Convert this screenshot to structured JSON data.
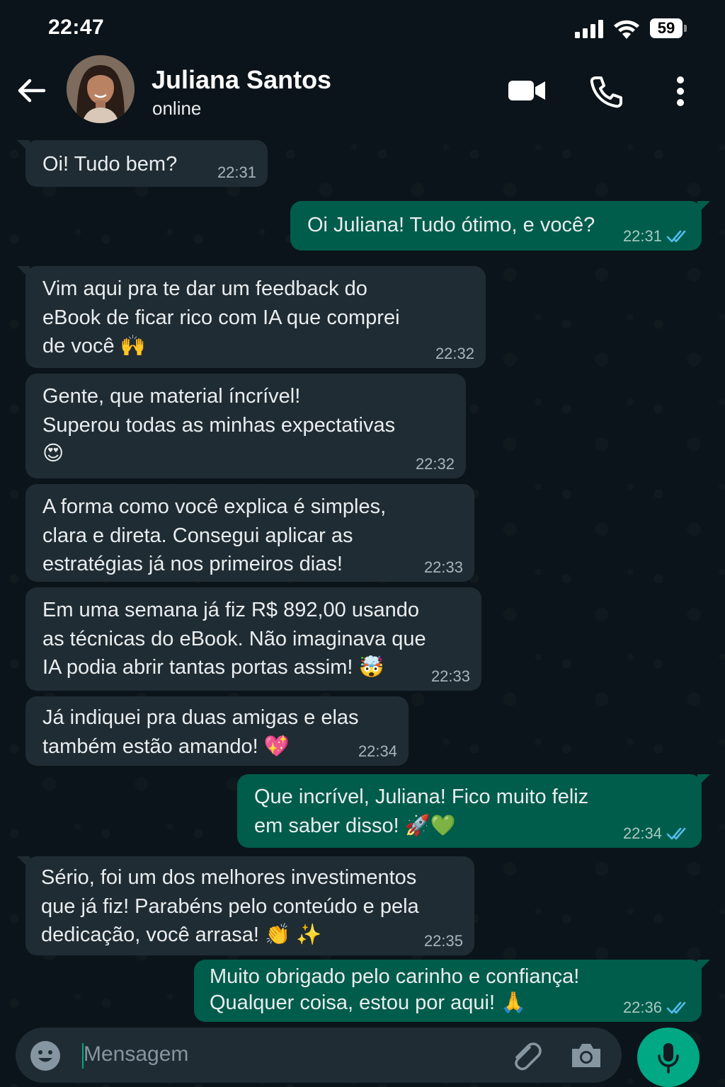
{
  "status_bar": {
    "time": "22:47",
    "battery": "59"
  },
  "header": {
    "contact_name": "Juliana Santos",
    "contact_status": "online"
  },
  "messages": [
    {
      "direction": "in",
      "text": "Oi! Tudo bem?",
      "time": "22:31"
    },
    {
      "direction": "out",
      "text": "Oi Juliana! Tudo ótimo, e você?",
      "time": "22:31",
      "status": "read"
    },
    {
      "direction": "in",
      "text": "Vim aqui pra te dar um feedback do\neBook de ficar rico com IA que comprei\nde você 🙌",
      "time": "22:32"
    },
    {
      "direction": "in",
      "text": "Gente, que material íncrível!\nSuperou todas as minhas expectativas\n😍",
      "time": "22:32"
    },
    {
      "direction": "in",
      "text": "A forma como você explica é simples,\nclara e direta. Consegui aplicar as\nestratégias já nos primeiros dias!",
      "time": "22:33"
    },
    {
      "direction": "in",
      "text": "Em uma semana já fiz R$ 892,00 usando\nas técnicas do eBook. Não imaginava que\nIA podia abrir tantas portas assim! 🤯",
      "time": "22:33"
    },
    {
      "direction": "in",
      "text": "Já indiquei pra duas amigas e elas\ntambém estão amando! 💖",
      "time": "22:34"
    },
    {
      "direction": "out",
      "text": "Que incrível, Juliana! Fico muito feliz\nem saber disso! 🚀💚",
      "time": "22:34",
      "status": "read"
    },
    {
      "direction": "in",
      "text": "Sério, foi um dos melhores investimentos\nque já fiz! Parabéns pelo conteúdo e pela\ndedicação, você arrasa! 👏 ✨",
      "time": "22:35"
    },
    {
      "direction": "out",
      "text": "Muito obrigado pelo carinho e confiança!\nQualquer coisa, estou por aqui! 🙏",
      "time": "22:36",
      "status": "read"
    }
  ],
  "composer": {
    "placeholder": "Mensagem"
  },
  "icons": {
    "back": "arrow-left-icon",
    "video": "video-camera-icon",
    "call": "phone-icon",
    "menu": "more-vertical-icon",
    "emoji": "emoji-icon",
    "attach": "paperclip-icon",
    "camera": "camera-icon",
    "mic": "microphone-icon",
    "read_receipt": "double-check-icon"
  },
  "colors": {
    "background": "#0b141a",
    "incoming_bubble": "#202c33",
    "outgoing_bubble": "#005c4b",
    "accent": "#00a884",
    "read_ticks": "#53bdeb"
  }
}
